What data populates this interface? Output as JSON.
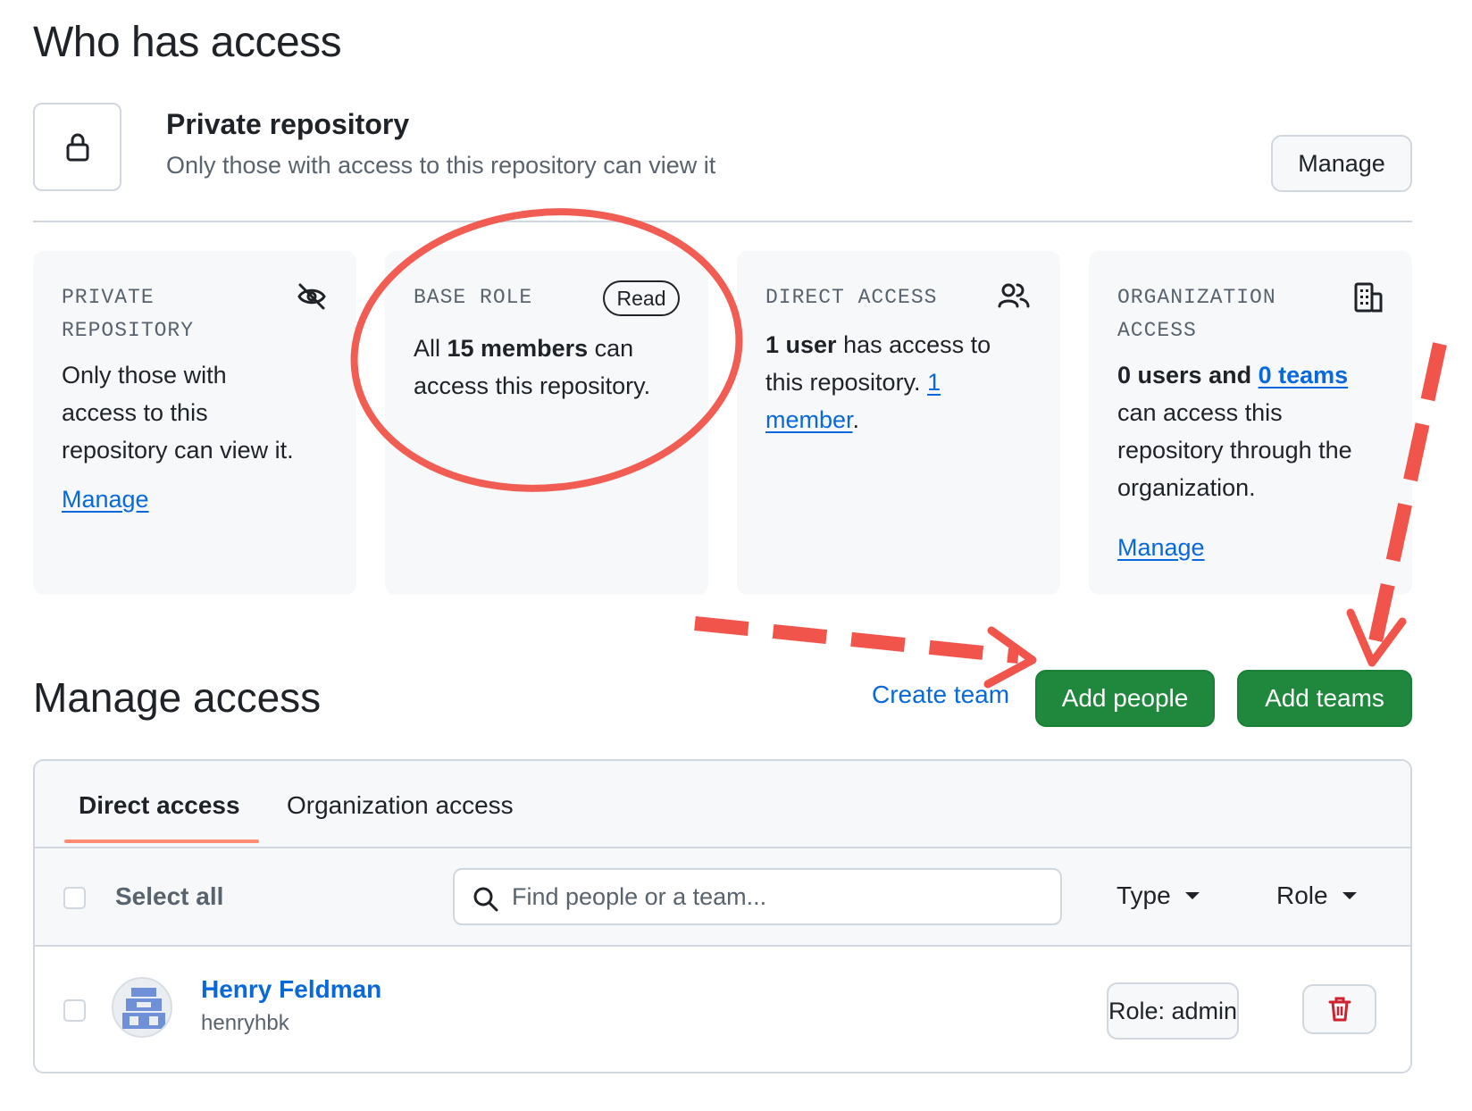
{
  "page": {
    "title": "Who has access"
  },
  "visibility": {
    "icon": "lock-icon",
    "title": "Private repository",
    "description": "Only those with access to this repository can view it",
    "manage_label": "Manage"
  },
  "cards": {
    "private": {
      "label_line1": "PRIVATE",
      "label_line2": "REPOSITORY",
      "icon": "eye-closed-icon",
      "text_line1": "Only those with",
      "text_line2": "access to this",
      "text_line3": "repository can view it.",
      "link": "Manage"
    },
    "base_role": {
      "label": "BASE ROLE",
      "badge": "Read",
      "prefix": "All ",
      "bold": "15 members",
      "suffix": " can",
      "line2": "access this repository."
    },
    "direct": {
      "label": "DIRECT ACCESS",
      "icon": "people-icon",
      "bold": "1 user",
      "suffix": " has access to",
      "line2_prefix": "this repository. ",
      "link_part1": "1",
      "link_part2": "member",
      "period": "."
    },
    "organization": {
      "label_line1": "ORGANIZATION",
      "label_line2": "ACCESS",
      "icon": "organization-icon",
      "bold_prefix": "0 users and ",
      "link": "0 teams",
      "line2": "can access this",
      "line3": "repository through the",
      "line4": "organization.",
      "manage_link": "Manage"
    }
  },
  "manage_access": {
    "title": "Manage access",
    "create_team": "Create team",
    "add_people": "Add people",
    "add_teams": "Add teams",
    "tabs": [
      {
        "label": "Direct access",
        "selected": true
      },
      {
        "label": "Organization access",
        "selected": false
      }
    ],
    "select_all": "Select all",
    "search": {
      "placeholder": "Find people or a team...",
      "icon": "search-icon"
    },
    "filters": {
      "type": "Type",
      "role": "Role"
    },
    "members": [
      {
        "name": "Henry Feldman",
        "handle": "henryhbk",
        "role": "Role: admin"
      }
    ]
  },
  "colors": {
    "primary_green": "#1f883d",
    "link_blue": "#0969da",
    "annotation_red": "#f0544a",
    "tab_underline": "#fd8c73",
    "danger": "#cf222e"
  }
}
